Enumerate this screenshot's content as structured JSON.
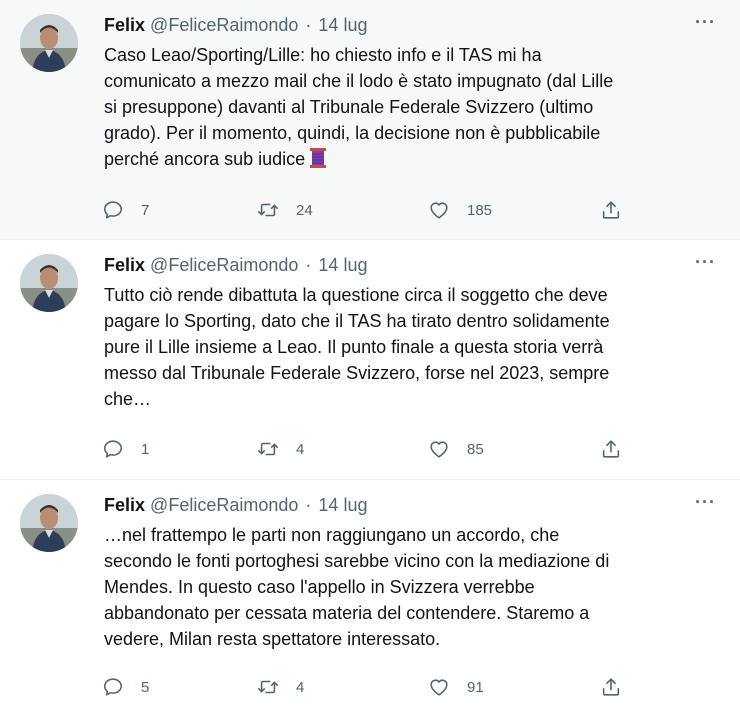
{
  "tweets": [
    {
      "author_name": "Felix",
      "handle": "@FeliceRaimondo",
      "separator": "·",
      "date": "14 lug",
      "text": "Caso Leao/Sporting/Lille: ho chiesto info e il TAS mi ha\ncomunicato a mezzo mail che il lodo è stato impugnato (dal Lille\nsi presuppone) davanti al Tribunale Federale Svizzero (ultimo\ngrado). Per il momento, quindi, la decisione non è pubblicabile\nperché ancora sub iudice",
      "emoji": "thread-spool-icon",
      "replies": "7",
      "retweets": "24",
      "likes": "185",
      "more_label": "···"
    },
    {
      "author_name": "Felix",
      "handle": "@FeliceRaimondo",
      "separator": "·",
      "date": "14 lug",
      "text": "Tutto ciò rende dibattuta la questione circa il soggetto che deve\npagare lo Sporting, dato che il TAS ha tirato dentro solidamente\npure il Lille insieme a Leao. Il punto finale a questa storia verrà\nmesso dal Tribunale Federale Svizzero, forse nel 2023, sempre\nche…",
      "replies": "1",
      "retweets": "4",
      "likes": "85",
      "more_label": "···"
    },
    {
      "author_name": "Felix",
      "handle": "@FeliceRaimondo",
      "separator": "·",
      "date": "14 lug",
      "text": "…nel frattempo le parti non raggiungano un accordo, che\nsecondo le fonti portoghesi sarebbe vicino con la mediazione di\nMendes. In questo caso l'appello in Svizzera verrebbe\nabbandonato per cessata materia del contendere. Staremo a\nvedere, Milan resta spettatore interessato.",
      "replies": "5",
      "retweets": "4",
      "likes": "91",
      "more_label": "···"
    }
  ],
  "icons": {
    "reply": "speech-bubble-icon",
    "retweet": "retweet-arrows-icon",
    "like": "heart-icon",
    "share": "share-upload-icon"
  },
  "colors": {
    "text_primary": "#0f1419",
    "text_secondary": "#536471",
    "highlight_bg": "#f7f9f9",
    "divider": "#eff3f4"
  }
}
